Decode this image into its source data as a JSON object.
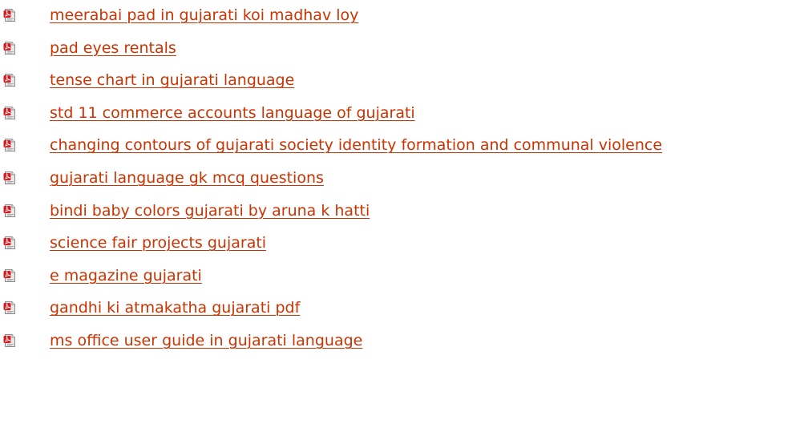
{
  "icon": "pdf-file-icon",
  "colors": {
    "link": "#cc3300",
    "icon_red": "#d8191e",
    "icon_page": "#e9e9e9"
  },
  "links": [
    {
      "label": "meerabai pad in gujarati koi madhav loy"
    },
    {
      "label": "pad eyes rentals"
    },
    {
      "label": "tense chart in gujarati language"
    },
    {
      "label": "std 11 commerce accounts language of gujarati"
    },
    {
      "label": "changing contours of gujarati society identity formation and communal violence"
    },
    {
      "label": "gujarati language gk mcq questions"
    },
    {
      "label": "bindi baby colors gujarati by aruna k hatti"
    },
    {
      "label": "science fair projects gujarati"
    },
    {
      "label": "e magazine gujarati"
    },
    {
      "label": "gandhi ki atmakatha gujarati pdf"
    },
    {
      "label": "ms office user guide in gujarati language"
    }
  ]
}
